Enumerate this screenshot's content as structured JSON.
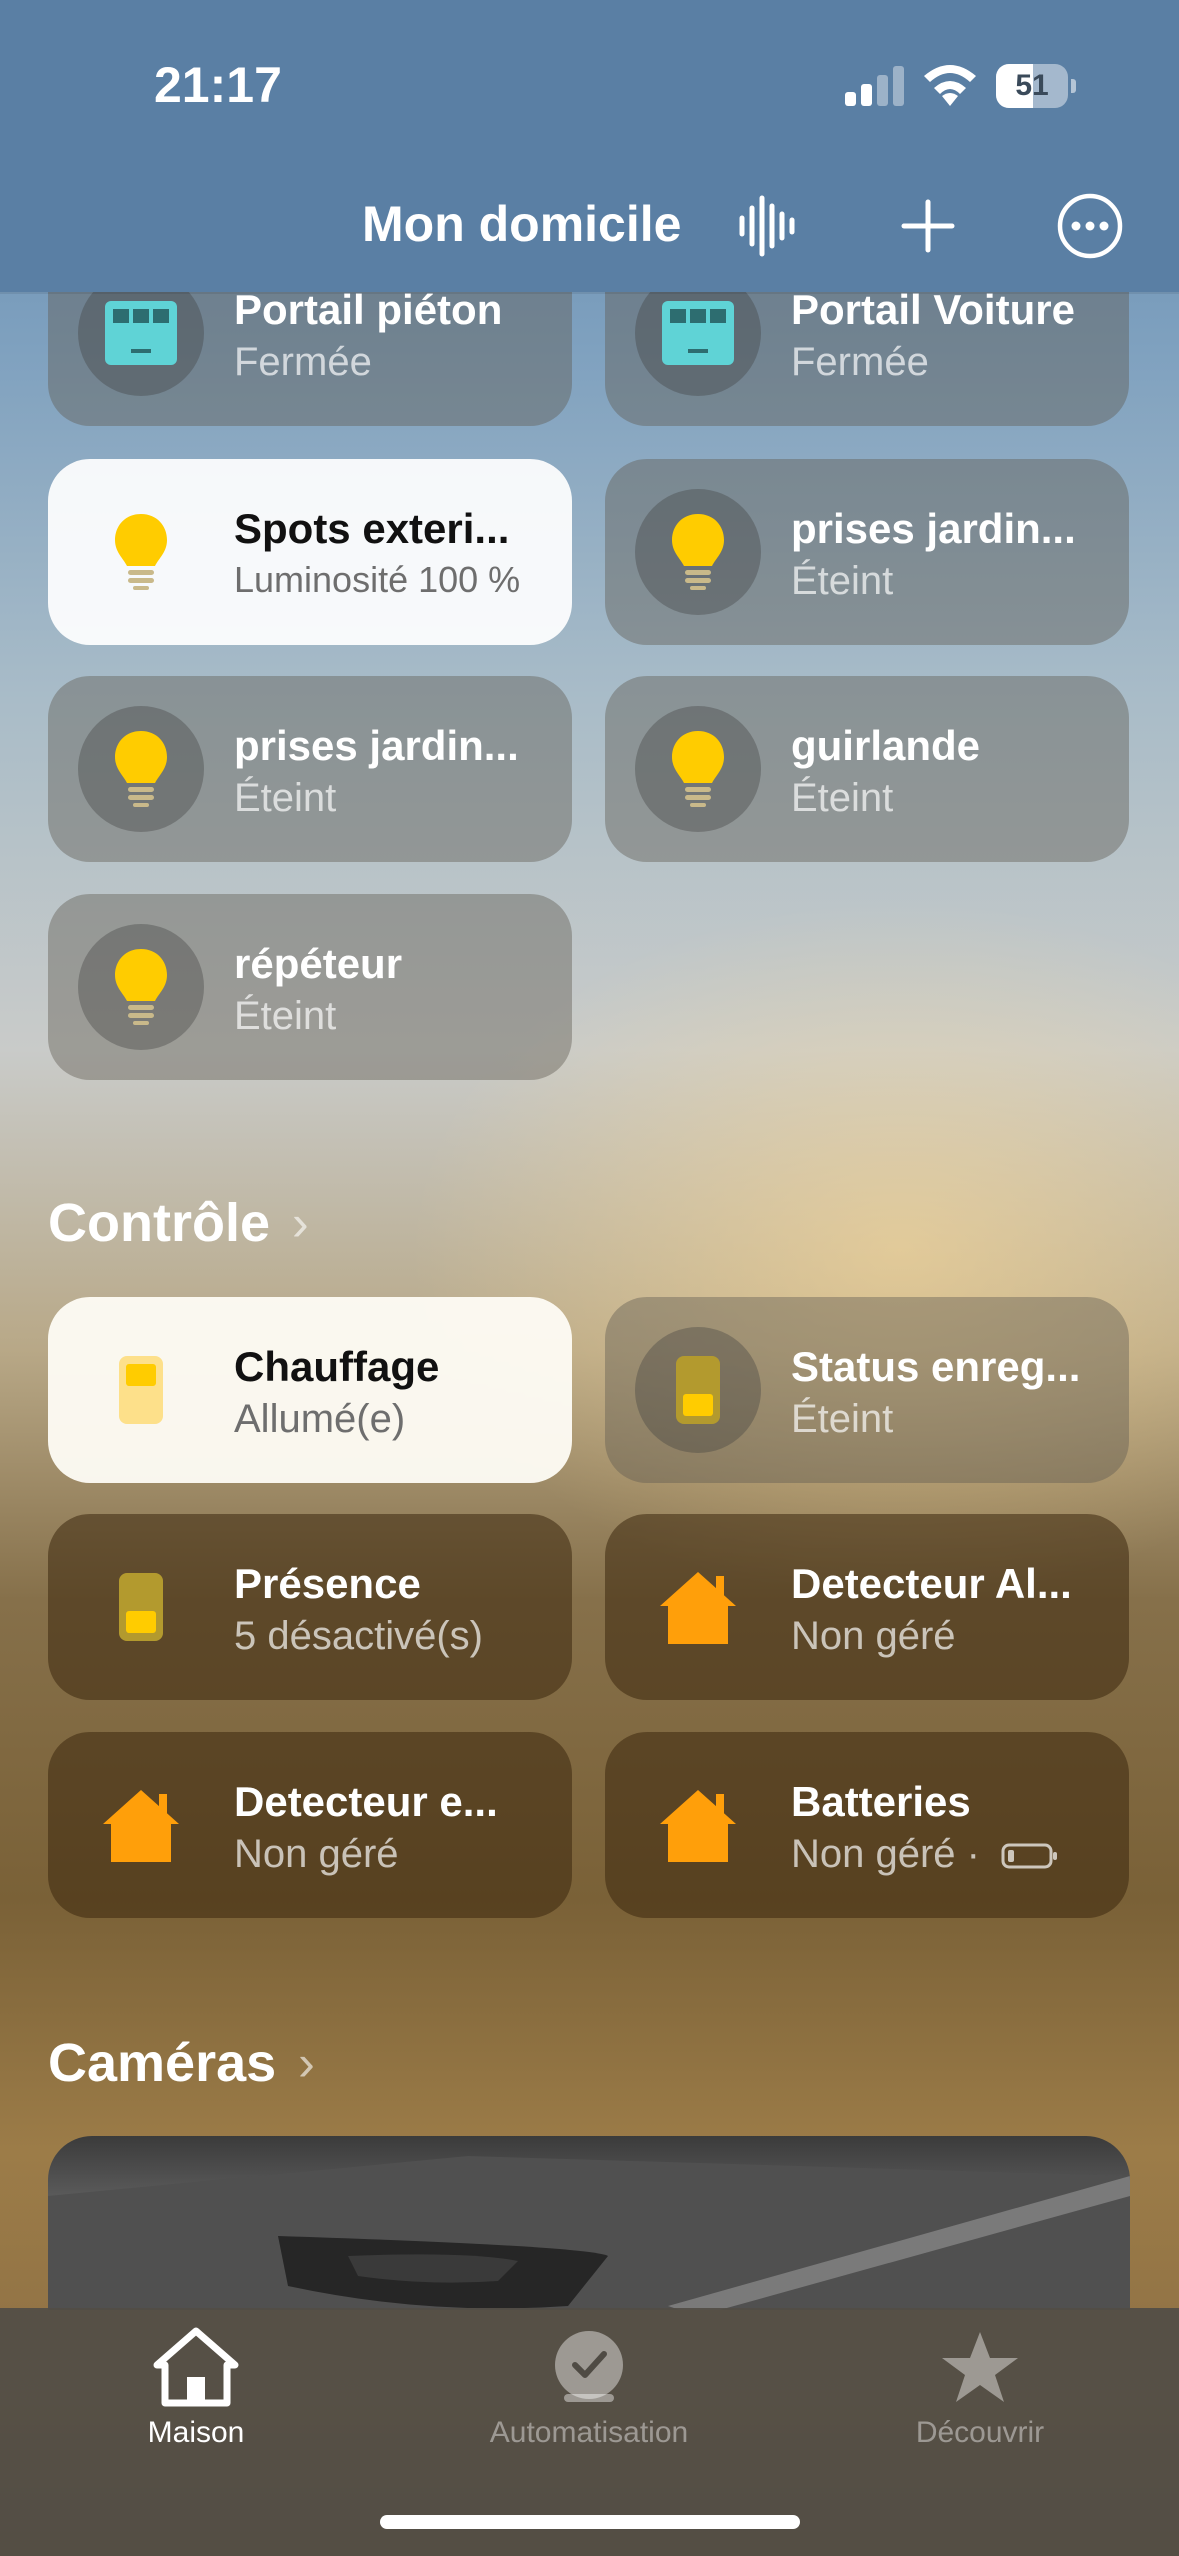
{
  "status_bar": {
    "time": "21:17",
    "battery_percent": 51,
    "battery_label": "51"
  },
  "header": {
    "title": "Mon domicile",
    "icons": [
      "voice-waveform-icon",
      "plus-icon",
      "more-icon"
    ]
  },
  "colors": {
    "header_bg": "#5a7fa4",
    "bulb_yellow": "#ffcc00",
    "home_orange": "#ff9f0a",
    "gate_teal": "#5fd3d6"
  },
  "tiles_top": [
    {
      "name": "Portail piéton",
      "status": "Fermée",
      "icon": "gate-icon",
      "state": "off"
    },
    {
      "name": "Portail Voiture",
      "status": "Fermée",
      "icon": "gate-icon",
      "state": "off"
    },
    {
      "name": "Spots exteri...",
      "status": "Luminosité 100 %",
      "icon": "bulb-icon",
      "state": "on"
    },
    {
      "name": "prises jardin...",
      "status": "Éteint",
      "icon": "bulb-icon",
      "state": "off"
    },
    {
      "name": "prises jardin...",
      "status": "Éteint",
      "icon": "bulb-icon",
      "state": "off"
    },
    {
      "name": "guirlande",
      "status": "Éteint",
      "icon": "bulb-icon",
      "state": "off"
    },
    {
      "name": "répéteur",
      "status": "Éteint",
      "icon": "bulb-icon",
      "state": "off"
    }
  ],
  "controle": {
    "title": "Contrôle",
    "tiles": [
      {
        "name": "Chauffage",
        "status": "Allumé(e)",
        "icon": "switch-icon",
        "state": "on"
      },
      {
        "name": "Status enreg...",
        "status": "Éteint",
        "icon": "switch-icon",
        "state": "off"
      },
      {
        "name": "Présence",
        "status": "5 désactivé(s)",
        "icon": "switch-icon",
        "state": "off"
      },
      {
        "name": "Detecteur Al...",
        "status": "Non géré",
        "icon": "home-icon",
        "state": "off"
      },
      {
        "name": "Detecteur e...",
        "status": "Non géré",
        "icon": "home-icon",
        "state": "off"
      },
      {
        "name": "Batteries",
        "status": "Non géré ·",
        "icon": "home-icon",
        "state": "off",
        "extra_icon": "low-battery-icon"
      }
    ]
  },
  "cameras": {
    "title": "Caméras"
  },
  "tabbar": {
    "tabs": [
      {
        "label": "Maison",
        "icon": "house-icon",
        "active": true
      },
      {
        "label": "Automatisation",
        "icon": "clock-check-icon",
        "active": false
      },
      {
        "label": "Découvrir",
        "icon": "star-icon",
        "active": false
      }
    ]
  }
}
